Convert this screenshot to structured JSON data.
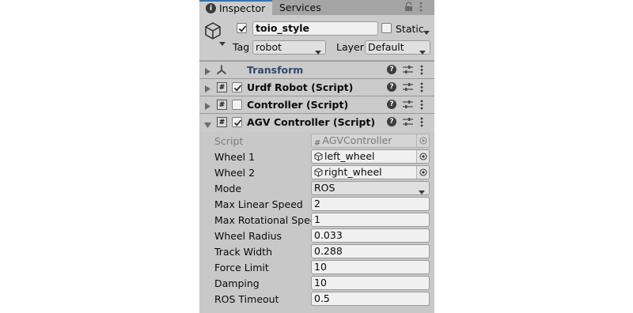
{
  "tabs": [
    {
      "label": "Inspector",
      "icon": "info-icon",
      "active": true
    },
    {
      "label": "Services",
      "active": false
    }
  ],
  "gameobject": {
    "active": true,
    "name": "toio_style",
    "static_label": "Static",
    "static": false,
    "tag_label": "Tag",
    "tag_value": "robot",
    "layer_label": "Layer",
    "layer_value": "Default"
  },
  "components": [
    {
      "title": "Transform",
      "expanded": false,
      "has_checkbox": false,
      "enabled": null,
      "icon": "transform-icon"
    },
    {
      "title": "Urdf Robot (Script)",
      "expanded": false,
      "has_checkbox": true,
      "enabled": true,
      "icon": "script-icon"
    },
    {
      "title": "Controller (Script)",
      "expanded": false,
      "has_checkbox": true,
      "enabled": false,
      "icon": "script-icon"
    },
    {
      "title": "AGV Controller (Script)",
      "expanded": true,
      "has_checkbox": true,
      "enabled": true,
      "icon": "script-icon"
    }
  ],
  "properties": [
    {
      "label": "Script",
      "value": "AGVController",
      "type": "script",
      "disabled": true
    },
    {
      "label": "Wheel 1",
      "value": "left_wheel",
      "type": "object"
    },
    {
      "label": "Wheel 2",
      "value": "right_wheel",
      "type": "object"
    },
    {
      "label": "Mode",
      "value": "ROS",
      "type": "enum"
    },
    {
      "label": "Max Linear Speed",
      "value": "2",
      "type": "number"
    },
    {
      "label": "Max Rotational Speed",
      "value": "1",
      "type": "number"
    },
    {
      "label": "Wheel Radius",
      "value": "0.033",
      "type": "number"
    },
    {
      "label": "Track Width",
      "value": "0.288",
      "type": "number"
    },
    {
      "label": "Force Limit",
      "value": "10",
      "type": "number"
    },
    {
      "label": "Damping",
      "value": "10",
      "type": "number"
    },
    {
      "label": "ROS Timeout",
      "value": "0.5",
      "type": "number"
    }
  ],
  "colors": {
    "accent": "#3a72b0",
    "panel_bg": "#c8c8c8",
    "header_bg": "#cbcbcb",
    "tab_bar": "#a5a5a5",
    "transform_title": "#344a6b"
  }
}
